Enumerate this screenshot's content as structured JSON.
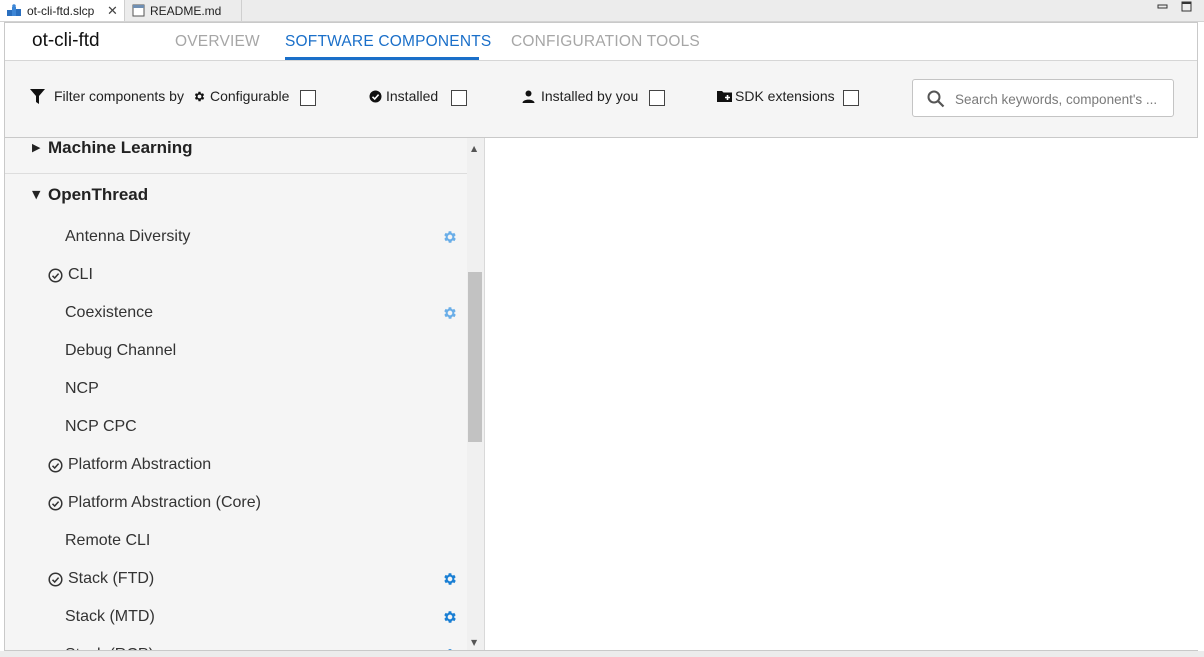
{
  "editor_tabs": [
    {
      "label": "ot-cli-ftd.slcp",
      "active": true
    },
    {
      "label": "README.md",
      "active": false
    }
  ],
  "window_controls": {
    "minimize": "▭",
    "maximize": "▭"
  },
  "header": {
    "title": "ot-cli-ftd",
    "tabs": [
      {
        "label": "OVERVIEW",
        "active": false
      },
      {
        "label": "SOFTWARE COMPONENTS",
        "active": true
      },
      {
        "label": "CONFIGURATION TOOLS",
        "active": false
      }
    ]
  },
  "filter": {
    "label": "Filter components by",
    "options": [
      {
        "label": "Configurable",
        "icon": "gear-icon",
        "checked": false
      },
      {
        "label": "Installed",
        "icon": "check-circle-icon",
        "checked": false
      },
      {
        "label": "Installed by you",
        "icon": "person-icon",
        "checked": false
      },
      {
        "label": "SDK extensions",
        "icon": "folder-plus-icon",
        "checked": false
      }
    ],
    "search_placeholder": "Search keywords, component's ..."
  },
  "tree": {
    "categories": [
      {
        "label": "Machine Learning",
        "expanded": false
      },
      {
        "label": "OpenThread",
        "expanded": true
      }
    ],
    "items": [
      {
        "label": "Antenna Diversity",
        "installed": false,
        "configurable": true,
        "gear_color": "#6aaee8"
      },
      {
        "label": "CLI",
        "installed": true,
        "configurable": false
      },
      {
        "label": "Coexistence",
        "installed": false,
        "configurable": true,
        "gear_color": "#6aaee8"
      },
      {
        "label": "Debug Channel",
        "installed": false,
        "configurable": false
      },
      {
        "label": "NCP",
        "installed": false,
        "configurable": false
      },
      {
        "label": "NCP CPC",
        "installed": false,
        "configurable": false
      },
      {
        "label": "Platform Abstraction",
        "installed": true,
        "configurable": false
      },
      {
        "label": "Platform Abstraction (Core)",
        "installed": true,
        "configurable": false
      },
      {
        "label": "Remote CLI",
        "installed": false,
        "configurable": false
      },
      {
        "label": "Stack (FTD)",
        "installed": true,
        "configurable": true,
        "gear_color": "#1a7fd4"
      },
      {
        "label": "Stack (MTD)",
        "installed": false,
        "configurable": true,
        "gear_color": "#1a7fd4"
      },
      {
        "label": "Stack (RCP)",
        "installed": false,
        "configurable": true,
        "gear_color": "#1a7fd4"
      }
    ]
  },
  "colors": {
    "accent": "#1a6fc9",
    "inactive_tab": "#a6a6a6",
    "gear_light": "#6aaee8",
    "gear_dark": "#1a7fd4"
  }
}
